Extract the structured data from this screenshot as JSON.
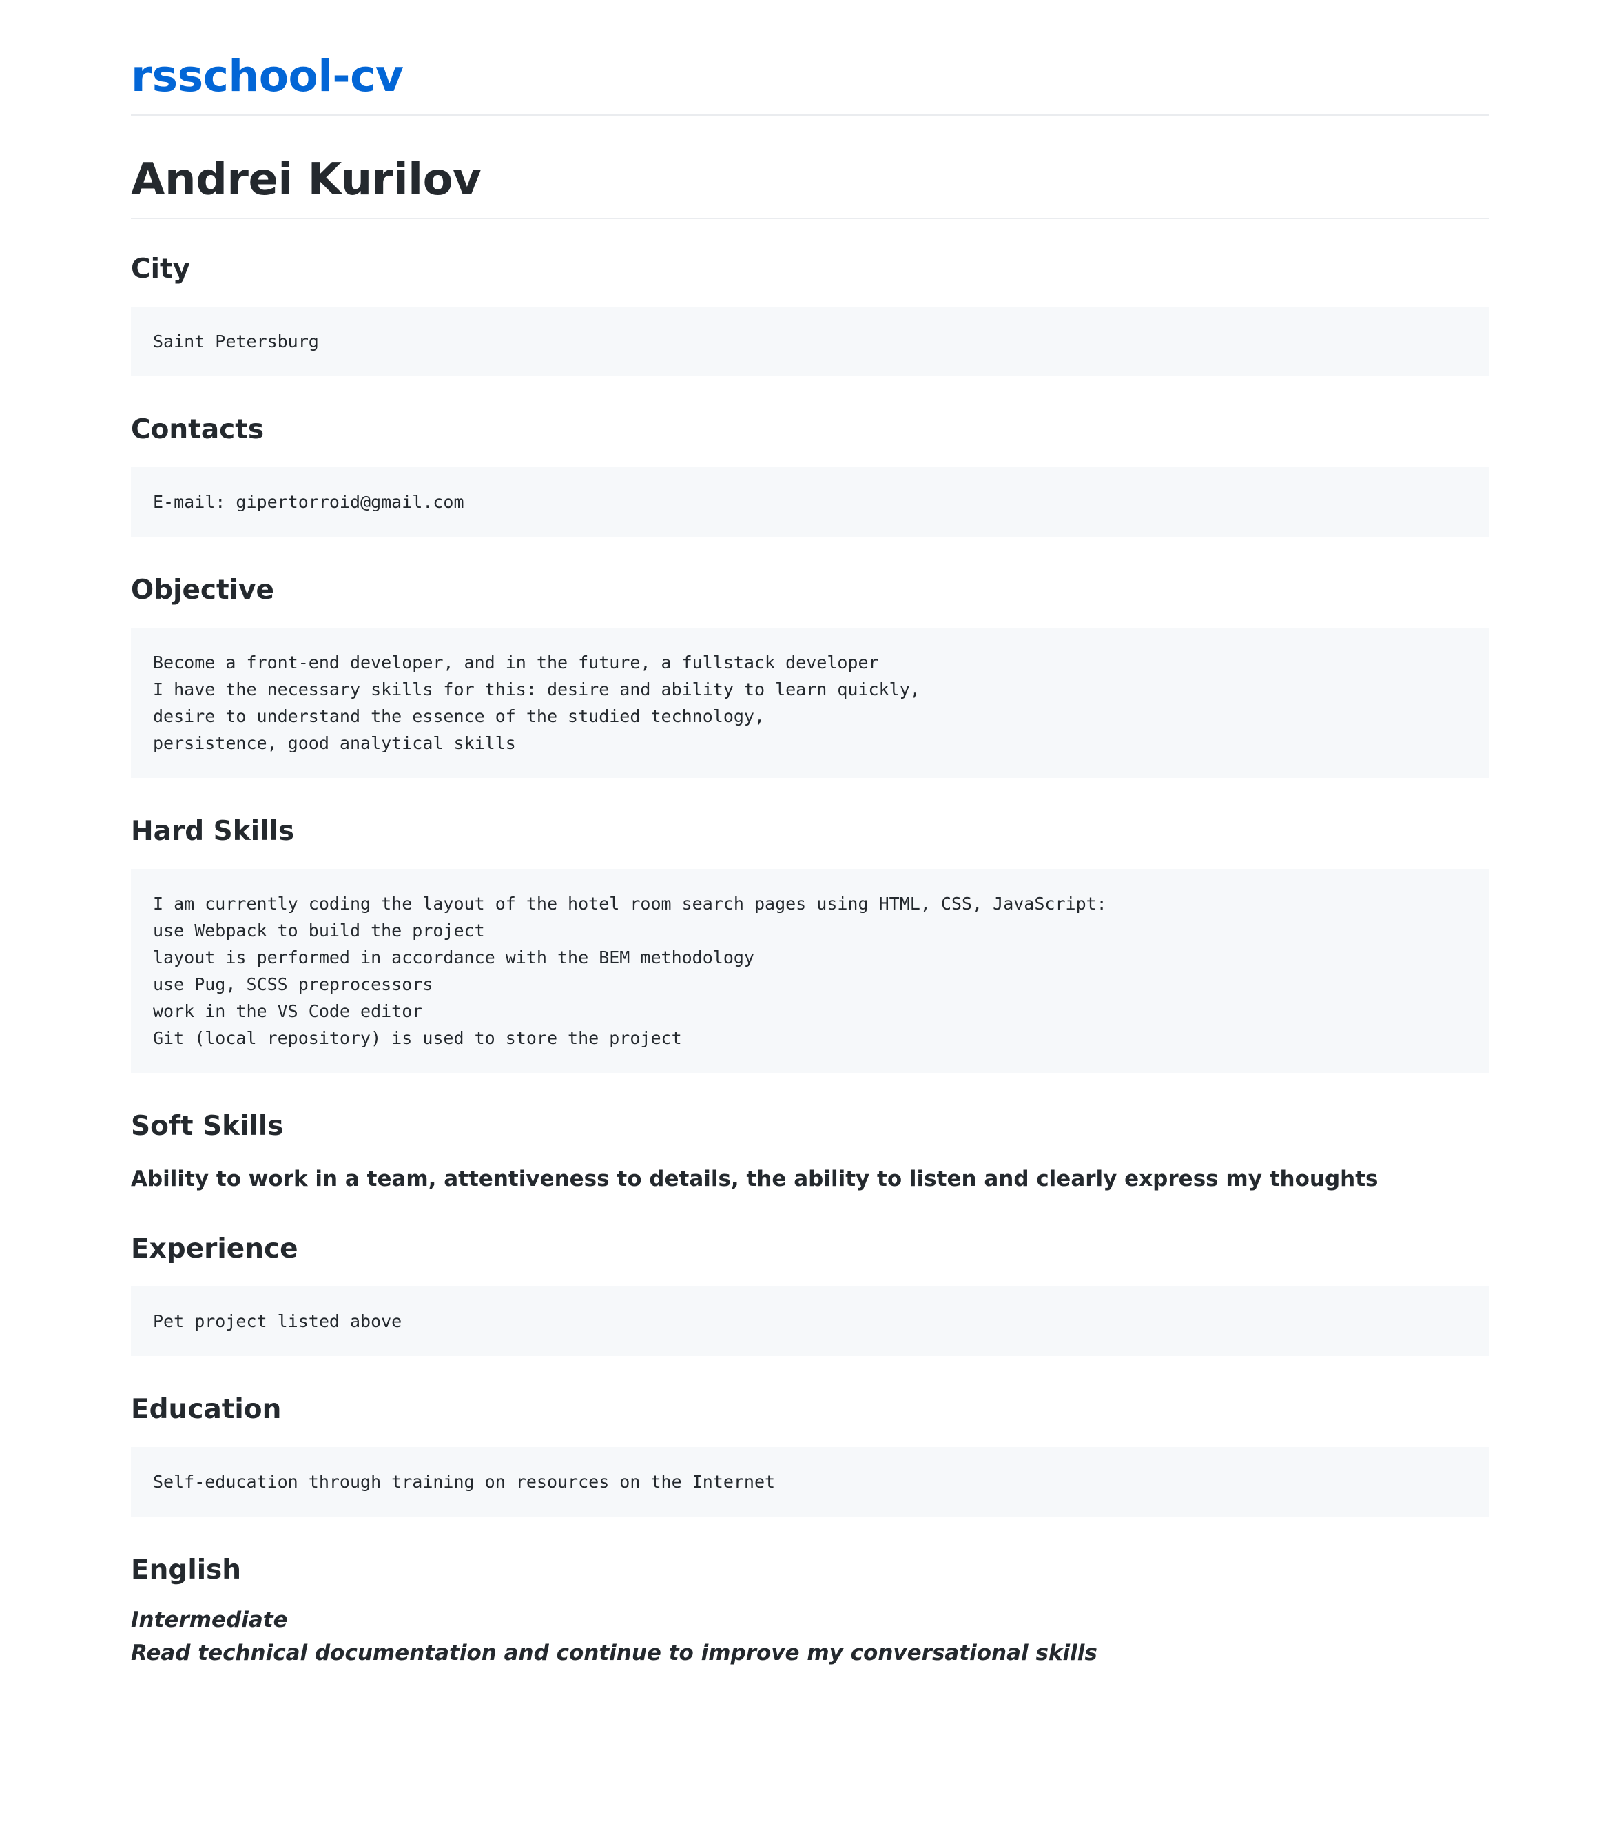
{
  "site": {
    "title": "rsschool-cv"
  },
  "name": "Andrei Kurilov",
  "sections": {
    "city": {
      "heading": "City",
      "lines": [
        "Saint Petersburg"
      ]
    },
    "contacts": {
      "heading": "Contacts",
      "lines": [
        "E-mail: gipertorroid@gmail.com"
      ]
    },
    "objective": {
      "heading": "Objective",
      "lines": [
        "Become a front-end developer, and in the future, a fullstack developer",
        "I have the necessary skills for this: desire and ability to learn quickly,",
        "desire to understand the essence of the studied technology,",
        "persistence, good analytical skills"
      ]
    },
    "hard_skills": {
      "heading": "Hard Skills",
      "lines": [
        "I am currently coding the layout of the hotel room search pages using HTML, CSS, JavaScript:",
        "use Webpack to build the project",
        "layout is performed in accordance with the BEM methodology",
        "use Pug, SCSS preprocessors",
        "work in the VS Code editor",
        "Git (local repository) is used to store the project"
      ]
    },
    "soft_skills": {
      "heading": "Soft Skills",
      "text": "Ability to work in a team, attentiveness to details, the ability to listen and clearly express my thoughts"
    },
    "experience": {
      "heading": "Experience",
      "lines": [
        "Pet project listed above"
      ]
    },
    "education": {
      "heading": "Education",
      "lines": [
        "Self-education through training on resources on the Internet"
      ]
    },
    "english": {
      "heading": "English",
      "level": "Intermediate",
      "note": "Read technical documentation and continue to improve my conversational skills"
    }
  }
}
